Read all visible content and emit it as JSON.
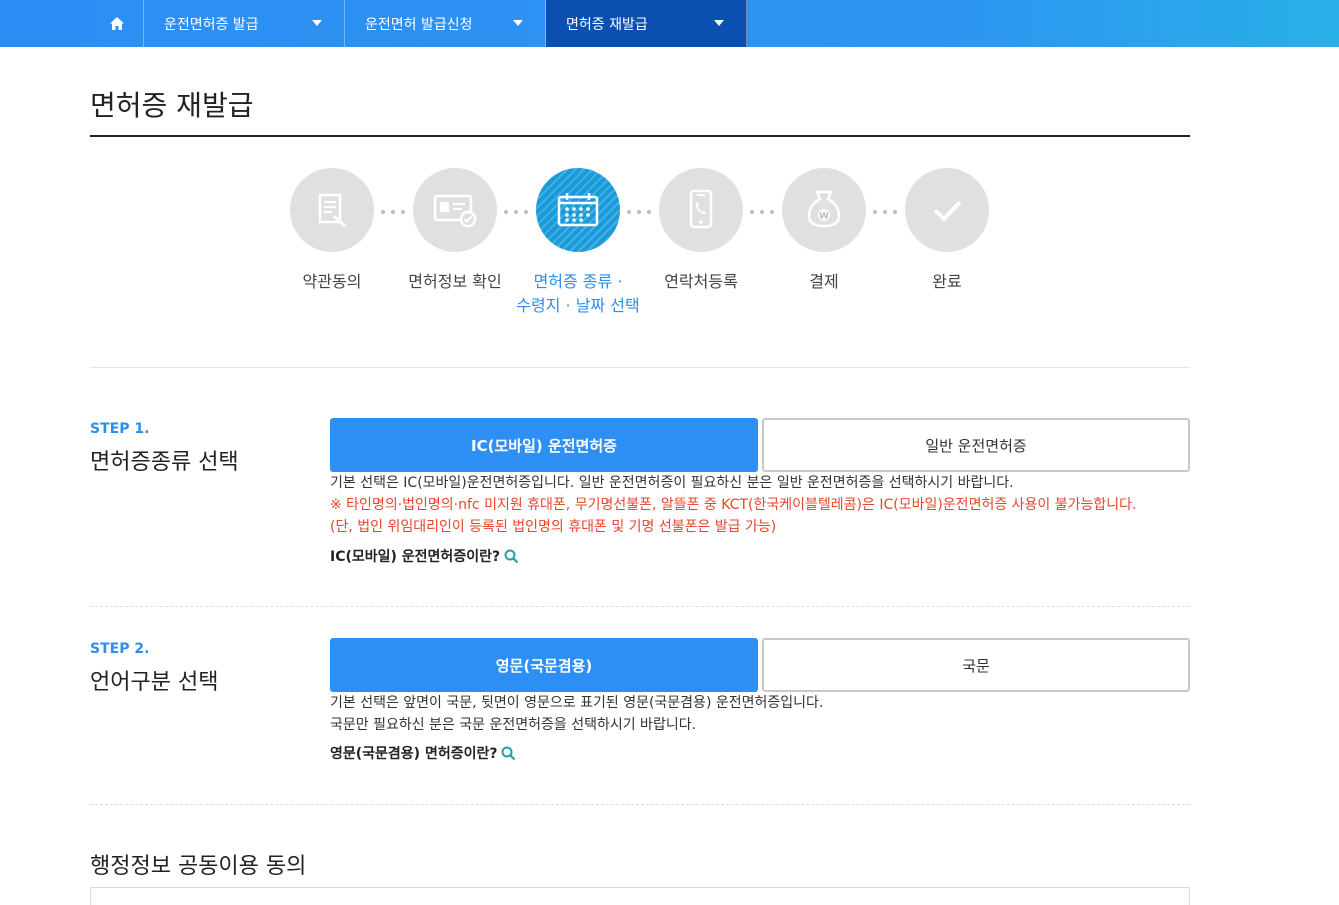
{
  "nav": {
    "home_icon": "home-icon",
    "items": [
      {
        "label": "운전면허증 발급"
      },
      {
        "label": "운전면허 발급신청"
      },
      {
        "label": "면허증 재발급"
      }
    ]
  },
  "page": {
    "title": "면허증 재발급"
  },
  "progress": {
    "steps": [
      {
        "label": "약관동의",
        "icon": "document-edit-icon"
      },
      {
        "label": "면허정보 확인",
        "icon": "id-card-check-icon"
      },
      {
        "label_line1": "면허증 종류 ·",
        "label_line2": "수령지 · 날짜 선택",
        "icon": "calendar-icon"
      },
      {
        "label": "연락처등록",
        "icon": "phone-icon"
      },
      {
        "label": "결제",
        "icon": "money-bag-icon"
      },
      {
        "label": "완료",
        "icon": "check-icon"
      }
    ],
    "current_index": 2
  },
  "step1": {
    "number": "STEP 1.",
    "title": "면허증종류 선택",
    "options": [
      "IC(모바일) 운전면허증",
      "일반 운전면허증"
    ],
    "selected": "IC(모바일) 운전면허증",
    "desc": "기본 선택은 IC(모바일)운전면허증입니다. 일반 운전면허증이 필요하신 분은 일반 운전면허증을 선택하시기 바랍니다.",
    "warn_line1": "※ 타인명의·법인명의·nfc 미지원 휴대폰, 무기명선불폰, 알뜰폰 중 KCT(한국케이블텔레콤)은 IC(모바일)운전면허증 사용이 불가능합니다.",
    "warn_line2": "(단, 법인 위임대리인이 등록된 법인명의 휴대폰 및 기명 선불폰은 발급 가능)",
    "help": "IC(모바일) 운전면허증이란?"
  },
  "step2": {
    "number": "STEP 2.",
    "title": "언어구분 선택",
    "options": [
      "영문(국문겸용)",
      "국문"
    ],
    "selected": "영문(국문겸용)",
    "desc_line1": "기본 선택은 앞면이 국문, 뒷면이 영문으로 표기된 영문(국문겸용) 운전면허증입니다.",
    "desc_line2": "국문만 필요하신 분은 국문 운전면허증을 선택하시기 바랍니다.",
    "help": "영문(국문겸용) 면허증이란?"
  },
  "admin_share": {
    "title": "행정정보 공동이용 동의"
  },
  "colors": {
    "accent": "#2d8ef4",
    "nav_active": "#0b4fb0",
    "warn": "#e8452a"
  }
}
